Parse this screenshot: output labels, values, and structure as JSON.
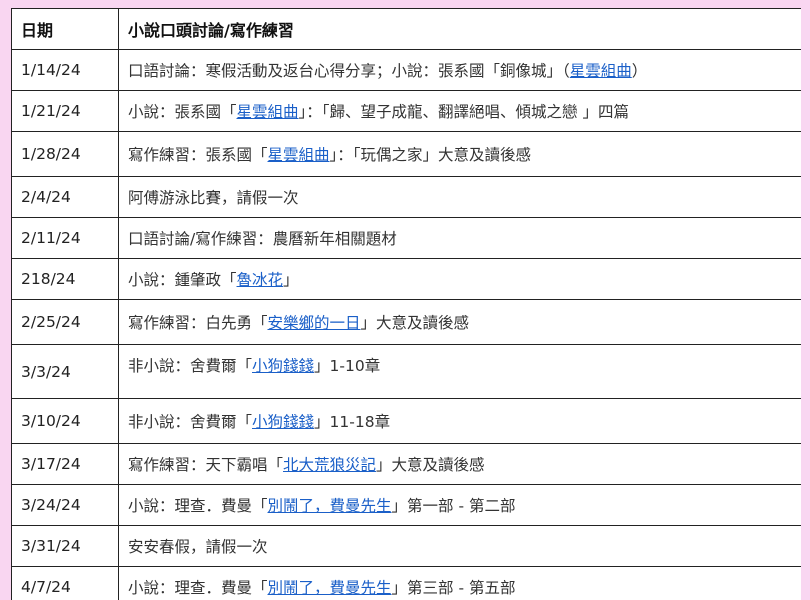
{
  "table": {
    "headers": {
      "date": "日期",
      "topic": "小說口頭討論/寫作練習"
    },
    "rows": [
      {
        "date": "1/14/24",
        "topic": [
          {
            "t": "口語討論：寒假活動及返台心得分享；小說：張系國「銅像城」（"
          },
          {
            "t": "星雲組曲",
            "link": true
          },
          {
            "t": "）"
          }
        ]
      },
      {
        "date": "1/21/24",
        "topic": [
          {
            "t": "小說：張系國「"
          },
          {
            "t": "星雲組曲",
            "link": true
          },
          {
            "t": "」：「歸、望子成龍、翻譯絕唱、傾城之戀 」四篇"
          }
        ]
      },
      {
        "date": "1/28/24",
        "topic": [
          {
            "t": "寫作練習：張系國「"
          },
          {
            "t": "星雲組曲",
            "link": true
          },
          {
            "t": "」：「玩偶之家」大意及讀後感"
          }
        ]
      },
      {
        "date": "2/4/24",
        "topic": [
          {
            "t": "阿傅游泳比賽，請假一次"
          }
        ]
      },
      {
        "date": "2/11/24",
        "topic": [
          {
            "t": "口語討論/寫作練習：農曆新年相關題材"
          }
        ]
      },
      {
        "date": "218/24",
        "topic": [
          {
            "t": "小說：鍾肇政「"
          },
          {
            "t": "魯冰花",
            "link": true
          },
          {
            "t": "」"
          }
        ]
      },
      {
        "date": "2/25/24",
        "topic": [
          {
            "t": "寫作練習：白先勇「"
          },
          {
            "t": "安樂鄉的一日",
            "link": true
          },
          {
            "t": "」大意及讀後感"
          }
        ]
      },
      {
        "date": "3/3/24",
        "topic": [
          {
            "t": "非小說：舍費爾「"
          },
          {
            "t": "小狗錢錢",
            "link": true
          },
          {
            "t": "」1-10章"
          }
        ]
      },
      {
        "date": "3/10/24",
        "topic": [
          {
            "t": "非小說：舍費爾「"
          },
          {
            "t": "小狗錢錢",
            "link": true
          },
          {
            "t": "」11-18章"
          }
        ]
      },
      {
        "date": "3/17/24",
        "topic": [
          {
            "t": "寫作練習：天下霸唱「"
          },
          {
            "t": "北大荒狼災記",
            "link": true
          },
          {
            "t": "」大意及讀後感"
          }
        ]
      },
      {
        "date": "3/24/24",
        "topic": [
          {
            "t": "小說：理查．費曼「"
          },
          {
            "t": "別鬧了，費曼先生",
            "link": true
          },
          {
            "t": "」第一部 - 第二部"
          }
        ]
      },
      {
        "date": "3/31/24",
        "topic": [
          {
            "t": "安安春假，請假一次"
          }
        ]
      },
      {
        "date": "4/7/24",
        "topic": [
          {
            "t": "小說：理查．費曼「"
          },
          {
            "t": "別鬧了，費曼先生",
            "link": true
          },
          {
            "t": "」第三部 - 第五部"
          }
        ]
      }
    ]
  },
  "colors": {
    "page_background": "#f9d6f1",
    "link": "#1a5fc8",
    "border": "#222222"
  }
}
